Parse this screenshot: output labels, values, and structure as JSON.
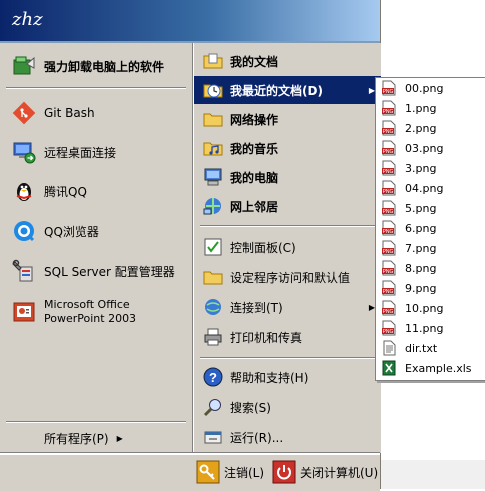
{
  "user": {
    "name": "zhz"
  },
  "colors": {
    "header_start": "#0a246a",
    "header_end": "#a6caf0",
    "highlight": "#0a246a",
    "menu_bg": "#d4d0c8"
  },
  "pinned": {
    "label": "强力卸载电脑上的软件",
    "icon": "uninstall-icon"
  },
  "recent_programs": [
    {
      "label": "Git Bash",
      "icon": "git-bash-icon"
    },
    {
      "label": "远程桌面连接",
      "icon": "remote-desktop-icon"
    },
    {
      "label": "腾讯QQ",
      "icon": "qq-penguin-icon"
    },
    {
      "label": "QQ浏览器",
      "icon": "qq-browser-icon"
    },
    {
      "label": "SQL Server 配置管理器",
      "icon": "sql-config-tool-icon"
    },
    {
      "label": "Microsoft Office PowerPoint 2003",
      "icon": "powerpoint-icon"
    }
  ],
  "all_programs": {
    "label": "所有程序(P)",
    "arrow": "▶"
  },
  "places": [
    {
      "label": "我的文档",
      "icon": "my-documents-icon"
    },
    {
      "label": "我最近的文档(D)",
      "icon": "recent-documents-icon",
      "active": true,
      "arrow": "▶"
    },
    {
      "label": "网络操作",
      "icon": "folder-icon"
    },
    {
      "label": "我的音乐",
      "icon": "music-folder-icon"
    },
    {
      "label": "我的电脑",
      "icon": "computer-icon"
    },
    {
      "label": "网上邻居",
      "icon": "network-icon"
    }
  ],
  "settings": [
    {
      "label": "控制面板(C)",
      "icon": "control-panel-icon"
    },
    {
      "label": "设定程序访问和默认值",
      "icon": "folder-icon"
    },
    {
      "label": "连接到(T)",
      "icon": "connect-icon",
      "arrow": "▶"
    },
    {
      "label": "打印机和传真",
      "icon": "printer-icon"
    }
  ],
  "help": [
    {
      "label": "帮助和支持(H)",
      "icon": "help-icon"
    },
    {
      "label": "搜索(S)",
      "icon": "search-icon"
    },
    {
      "label": "运行(R)...",
      "icon": "run-icon"
    }
  ],
  "footer": {
    "logoff": "注销(L)",
    "shutdown": "关闭计算机(U)"
  },
  "recent_docs": [
    {
      "name": "00.png",
      "type": "png"
    },
    {
      "name": "1.png",
      "type": "png"
    },
    {
      "name": "2.png",
      "type": "png"
    },
    {
      "name": "03.png",
      "type": "png"
    },
    {
      "name": "3.png",
      "type": "png"
    },
    {
      "name": "04.png",
      "type": "png"
    },
    {
      "name": "5.png",
      "type": "png"
    },
    {
      "name": "6.png",
      "type": "png"
    },
    {
      "name": "7.png",
      "type": "png"
    },
    {
      "name": "8.png",
      "type": "png"
    },
    {
      "name": "9.png",
      "type": "png"
    },
    {
      "name": "10.png",
      "type": "png"
    },
    {
      "name": "11.png",
      "type": "png"
    },
    {
      "name": "dir.txt",
      "type": "txt"
    },
    {
      "name": "Example.xls",
      "type": "xls"
    }
  ]
}
